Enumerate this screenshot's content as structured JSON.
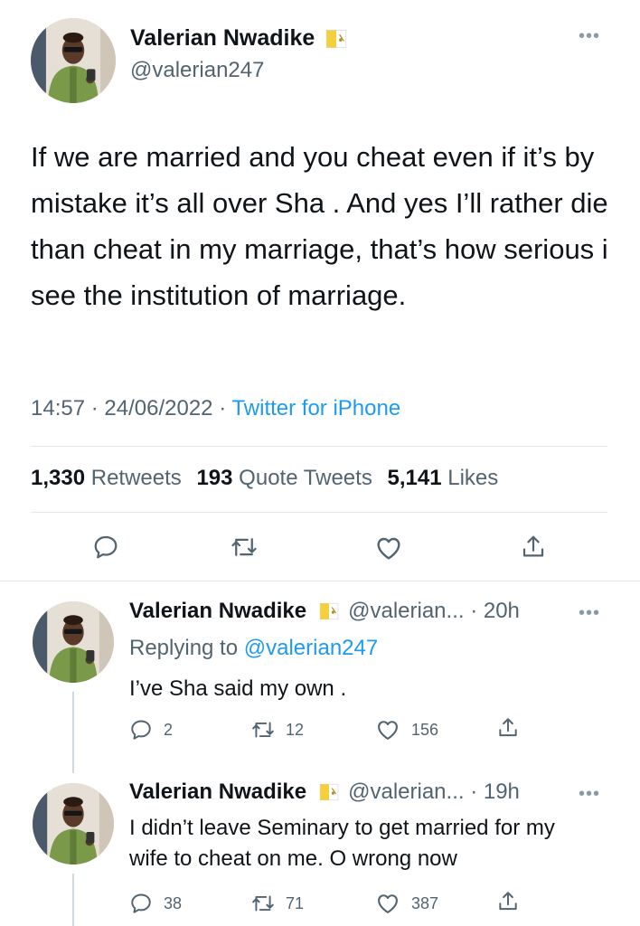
{
  "main_tweet": {
    "author_name": "Valerian Nwadike",
    "handle": "@valerian247",
    "text": "If we are married and you cheat even if it’s by mistake it’s all over Sha . And yes I’ll rather die than cheat in my marriage, that’s how serious i see the institution of marriage.",
    "time": "14:57",
    "date": "24/06/2022",
    "separator": "·",
    "source": "Twitter for iPhone",
    "stats": {
      "retweets_count": "1,330",
      "retweets_label": "Retweets",
      "quotes_count": "193",
      "quotes_label": "Quote Tweets",
      "likes_count": "5,141",
      "likes_label": "Likes"
    }
  },
  "replies": [
    {
      "author_name": "Valerian Nwadike",
      "handle_time": "@valerian... · 20h",
      "replying_label": "Replying to",
      "replying_to": "@valerian247",
      "text": "I’ve Sha said my own .",
      "reply_count": "2",
      "retweet_count": "12",
      "like_count": "156"
    },
    {
      "author_name": "Valerian Nwadike",
      "handle_time": "@valerian... · 19h",
      "text": "I didn’t leave Seminary to get married for my wife to cheat on me. O wrong now",
      "reply_count": "38",
      "retweet_count": "71",
      "like_count": "387"
    }
  ],
  "icons": {
    "more": "more-horizontal-icon",
    "flag": "vatican-flag-icon",
    "reply": "reply-icon",
    "retweet": "retweet-icon",
    "like": "heart-icon",
    "share": "share-icon"
  },
  "colors": {
    "text": "#0f1419",
    "secondary": "#536471",
    "link": "#1d9bf0",
    "divider": "#e1e8ed"
  }
}
